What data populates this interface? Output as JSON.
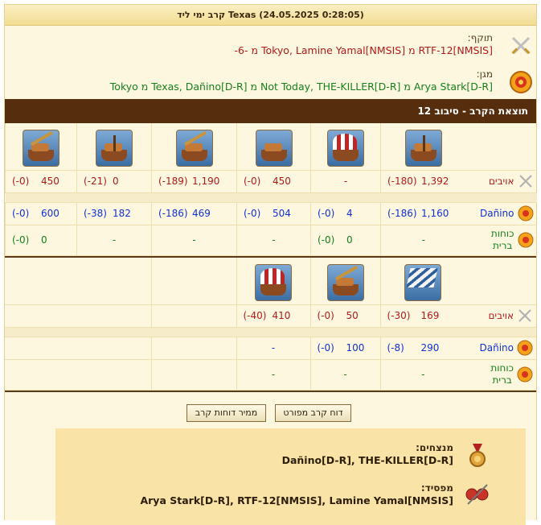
{
  "report": {
    "title": "קרב ימי ליד Texas (24.05.2025 0:28:05)",
    "attacker_label": "תוקף:",
    "attacker_names": "RTF-12[NMSIS] מ Tokyo, Lamine Yamal[NMSIS] מ -6-",
    "defender_label": "מגן:",
    "defender_names": "Arya Stark[D-R] מ Not Today, THE-KILLER[D-R] מ Texas, Dañino[D-R] מ Tokyo",
    "result_title": "תוצאת הקרב - סיבוב 12"
  },
  "rows": {
    "enemies": "אויבים",
    "danino": "Dañino",
    "allies_line1": "כוחות",
    "allies_line2": "ברית"
  },
  "block1": {
    "units": [
      "ship-ballista",
      "ship-ram-red-sail",
      "ship-flamethrower",
      "ship-paddle-catapult",
      "ship-steam-ram",
      "ship-mortar"
    ],
    "enemies": [
      {
        "v": "1,392",
        "l": "(-180)"
      },
      {
        "dash": "-"
      },
      {
        "v": "450",
        "l": "(-0)"
      },
      {
        "v": "1,190",
        "l": "(-189)"
      },
      {
        "v": "0",
        "l": "(-21)"
      },
      {
        "v": "450",
        "l": "(-0)"
      }
    ],
    "danino": [
      {
        "v": "1,160",
        "l": "(-186)"
      },
      {
        "v": "4",
        "l": "(-0)"
      },
      {
        "v": "504",
        "l": "(-0)"
      },
      {
        "v": "469",
        "l": "(-186)"
      },
      {
        "v": "182",
        "l": "(-38)"
      },
      {
        "v": "600",
        "l": "(-0)"
      }
    ],
    "allies": [
      {
        "dash": "-"
      },
      {
        "v": "0",
        "l": "(-0)"
      },
      {
        "dash": "-"
      },
      {
        "dash": "-"
      },
      {
        "dash": "-"
      },
      {
        "v": "0",
        "l": "(-0)"
      }
    ]
  },
  "block2": {
    "units": [
      "ship-sail-striped",
      "ship-catapult",
      "ship-red-white-balloon"
    ],
    "enemies": [
      {
        "v": "169",
        "l": "(-30)"
      },
      {
        "v": "50",
        "l": "(-0)"
      },
      {
        "v": "410",
        "l": "(-40)"
      }
    ],
    "danino": [
      {
        "v": "290",
        "l": "(-8)"
      },
      {
        "v": "100",
        "l": "(-0)"
      },
      {
        "dash": "-"
      }
    ],
    "allies": [
      {
        "dash": "-"
      },
      {
        "dash": "-"
      },
      {
        "dash": "-"
      }
    ]
  },
  "buttons": {
    "detailed": "דוח קרב מפורט",
    "convert": "ממיר דוחות קרב"
  },
  "summary": {
    "winners_label": "מנצחים:",
    "winners": "Dañino[D-R], THE-KILLER[D-R]",
    "losers_label": "מפסיד:",
    "losers": "Arya Stark[D-R], RTF-12[NMSIS], Lamine Yamal[NMSIS]"
  },
  "colors": {
    "enemy": "#b21a1a",
    "own": "#1030d8",
    "ally": "#15801a",
    "header_bar": "#562e0d"
  }
}
